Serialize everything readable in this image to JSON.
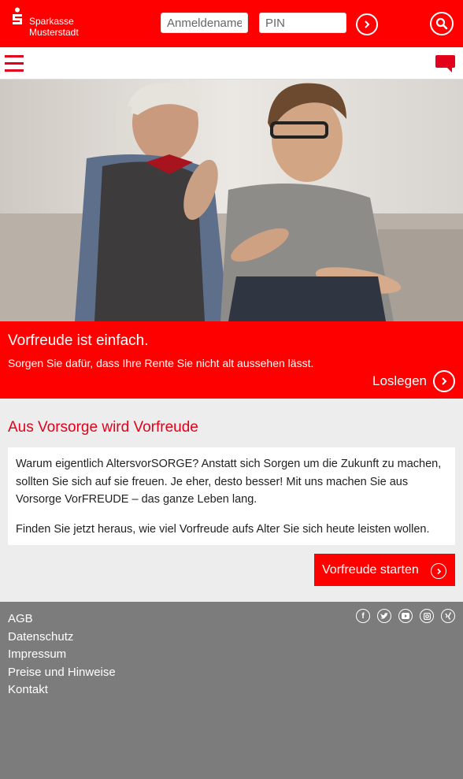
{
  "brand": {
    "line1": "Sparkasse",
    "line2": "Musterstadt",
    "color": "#ff0000"
  },
  "login": {
    "username_placeholder": "Anmeldename",
    "pin_placeholder": "PIN"
  },
  "icons": {
    "login_submit": "chevron-right-icon",
    "search": "search-icon",
    "menu": "hamburger-menu-icon",
    "chat": "chat-bubble-icon"
  },
  "hero": {
    "image": "two men laughing, high-five on sofa"
  },
  "teaser": {
    "title": "Vorfreude ist einfach.",
    "subtitle": "Sorgen Sie dafür, dass Ihre Rente Sie nicht alt aussehen lässt.",
    "cta_label": "Loslegen"
  },
  "main": {
    "heading": "Aus Vorsorge wird Vorfreude",
    "paragraph1": "Warum eigentlich AltersvorSORGE? Anstatt sich Sorgen um die Zukunft zu machen, sollten Sie sich auf sie freuen. Je eher, desto besser! Mit uns machen Sie aus Vorsorge VorFREUDE – das ganze Leben lang.",
    "paragraph2": "Finden Sie jetzt heraus, wie viel Vorfreude aufs Alter Sie sich heute leisten wollen.",
    "cta_label": "Vorfreude starten"
  },
  "footer": {
    "links": [
      "AGB",
      "Datenschutz",
      "Impressum",
      "Preise und Hinweise",
      "Kontakt"
    ],
    "social_icons": [
      "facebook-icon",
      "twitter-icon",
      "youtube-icon",
      "instagram-icon",
      "xing-icon"
    ]
  }
}
